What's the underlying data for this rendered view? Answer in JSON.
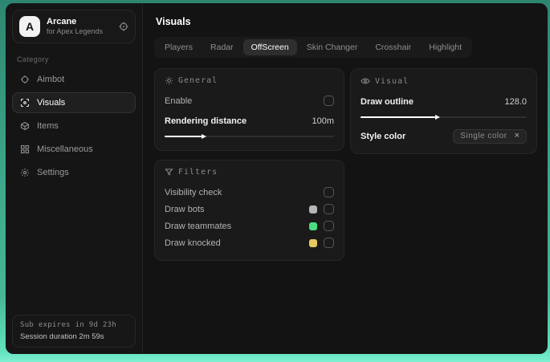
{
  "sidebar": {
    "logo_letter": "A",
    "app_name": "Arcane",
    "app_subtitle": "for Apex Legends",
    "category_label": "Category",
    "items": [
      {
        "label": "Aimbot"
      },
      {
        "label": "Visuals"
      },
      {
        "label": "Items"
      },
      {
        "label": "Miscellaneous"
      },
      {
        "label": "Settings"
      }
    ],
    "footer": {
      "sub_expires": "Sub expires in 9d 23h",
      "session_duration": "Session duration 2m 59s"
    }
  },
  "main": {
    "title": "Visuals",
    "tabs": [
      {
        "label": "Players"
      },
      {
        "label": "Radar"
      },
      {
        "label": "OffScreen"
      },
      {
        "label": "Skin Changer"
      },
      {
        "label": "Crosshair"
      },
      {
        "label": "Highlight"
      }
    ],
    "active_tab": "OffScreen",
    "panels": {
      "general": {
        "title": "General",
        "enable_label": "Enable",
        "rendering_label": "Rendering distance",
        "rendering_value": "100m",
        "rendering_fill": "22%"
      },
      "visual": {
        "title": "Visual",
        "outline_label": "Draw outline",
        "outline_value": "128.0",
        "outline_fill": "45%",
        "style_label": "Style color",
        "style_value": "Single color",
        "style_clear": "×"
      },
      "filters": {
        "title": "Filters",
        "rows": [
          {
            "label": "Visibility check",
            "swatch": ""
          },
          {
            "label": "Draw bots",
            "swatch": "#b4b6ba"
          },
          {
            "label": "Draw teammates",
            "swatch": "#4ade80"
          },
          {
            "label": "Draw knocked",
            "swatch": "#e7c95f"
          }
        ]
      }
    }
  }
}
